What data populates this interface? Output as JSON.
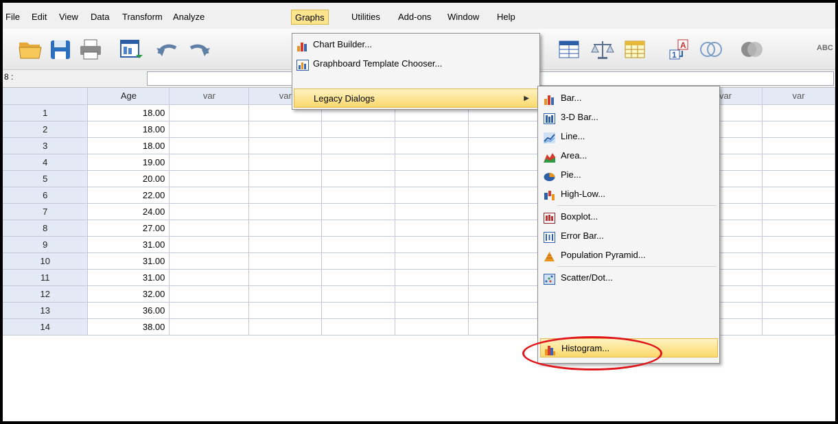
{
  "menubar": {
    "items": [
      "File",
      "Edit",
      "View",
      "Data",
      "Transform",
      "Analyze",
      "Graphs",
      "Utilities",
      "Add-ons",
      "Window",
      "Help"
    ],
    "active": "Graphs"
  },
  "toolbar": {
    "icons": [
      "open-folder-icon",
      "save-icon",
      "print-icon",
      "dialog-recall-icon",
      "undo-icon",
      "redo-icon",
      "split-file-icon",
      "weight-cases-icon",
      "select-cases-icon",
      "value-labels-icon",
      "use-sets-icon",
      "show-all-variables-icon",
      "spelling-icon"
    ],
    "partial_label": "ABC"
  },
  "cell_editor": {
    "reference": "8 :",
    "value": ""
  },
  "grid": {
    "columns": [
      "Age",
      "var",
      "var",
      "var",
      "var",
      "var",
      "var",
      "var",
      "var",
      "var"
    ],
    "rows": [
      {
        "n": "1",
        "age": "18.00"
      },
      {
        "n": "2",
        "age": "18.00"
      },
      {
        "n": "3",
        "age": "18.00"
      },
      {
        "n": "4",
        "age": "19.00"
      },
      {
        "n": "5",
        "age": "20.00"
      },
      {
        "n": "6",
        "age": "22.00"
      },
      {
        "n": "7",
        "age": "24.00"
      },
      {
        "n": "8",
        "age": "27.00"
      },
      {
        "n": "9",
        "age": "31.00"
      },
      {
        "n": "10",
        "age": "31.00"
      },
      {
        "n": "11",
        "age": "31.00"
      },
      {
        "n": "12",
        "age": "32.00"
      },
      {
        "n": "13",
        "age": "36.00"
      },
      {
        "n": "14",
        "age": "38.00"
      }
    ]
  },
  "graphs_menu": {
    "chart_builder": "Chart Builder...",
    "graphboard": "Graphboard Template Chooser...",
    "legacy": "Legacy Dialogs"
  },
  "legacy_menu": {
    "bar": "Bar...",
    "bar3d": "3-D Bar...",
    "line": "Line...",
    "area": "Area...",
    "pie": "Pie...",
    "highlow": "High-Low...",
    "boxplot": "Boxplot...",
    "errorbar": "Error Bar...",
    "pyramid": "Population Pyramid...",
    "scatter": "Scatter/Dot...",
    "histogram": "Histogram..."
  },
  "colors": {
    "highlight": "#fbd96c",
    "annotation": "#e0151b",
    "header_bg": "#e4eaf5"
  }
}
